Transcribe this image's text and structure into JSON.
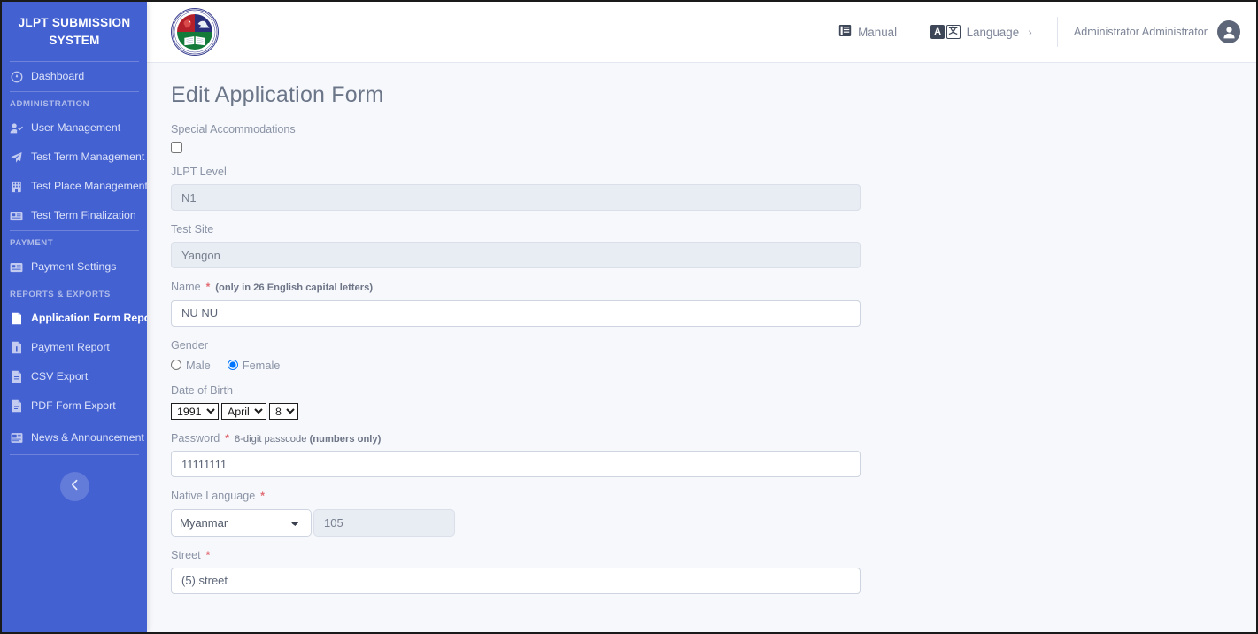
{
  "sidebar": {
    "brand": "JLPT SUBMISSION SYSTEM",
    "items": [
      {
        "label": "Dashboard",
        "icon": "dashboard-icon"
      }
    ],
    "sections": [
      {
        "title": "ADMINISTRATION",
        "items": [
          {
            "label": "User Management",
            "icon": "user-check-icon"
          },
          {
            "label": "Test Term Management",
            "icon": "paper-plane-icon"
          },
          {
            "label": "Test Place Management",
            "icon": "building-icon"
          },
          {
            "label": "Test Term Finalization",
            "icon": "card-icon"
          }
        ]
      },
      {
        "title": "PAYMENT",
        "items": [
          {
            "label": "Payment Settings",
            "icon": "card-icon"
          }
        ]
      },
      {
        "title": "REPORTS & EXPORTS",
        "items": [
          {
            "label": "Application Form Report",
            "icon": "file-icon",
            "active": true
          },
          {
            "label": "Payment Report",
            "icon": "file-icon"
          },
          {
            "label": "CSV Export",
            "icon": "file-icon"
          },
          {
            "label": "PDF Form Export",
            "icon": "file-icon"
          }
        ]
      },
      {
        "title": "",
        "items": [
          {
            "label": "News & Announcement",
            "icon": "news-icon"
          }
        ]
      }
    ],
    "collapse_label": "<",
    "accent_color": "#4461d2"
  },
  "topbar": {
    "logo_alt": "institute-seal-logo",
    "manual_label": "Manual",
    "language_label": "Language",
    "language_chevron": "›",
    "admin_name": "Administrator Administrator"
  },
  "page": {
    "title": "Edit Application Form"
  },
  "form": {
    "special_accommodations": {
      "label": "Special Accommodations",
      "checked": false
    },
    "jlpt_level": {
      "label": "JLPT Level",
      "value": "N1",
      "readonly": true
    },
    "test_site": {
      "label": "Test Site",
      "value": "Yangon",
      "readonly": true
    },
    "name": {
      "label": "Name",
      "required_mark": "*",
      "hint": "(only in 26 English capital letters)",
      "value": "NU NU",
      "placeholder": ""
    },
    "gender": {
      "label": "Gender",
      "options": [
        {
          "label": "Male",
          "selected": false
        },
        {
          "label": "Female",
          "selected": true
        }
      ]
    },
    "date_of_birth": {
      "label": "Date of Birth",
      "year": "1991",
      "month": "April",
      "day": "8"
    },
    "password": {
      "label": "Password",
      "required_mark": "*",
      "hint_normal": "8-digit passcode ",
      "hint_bold": "(numbers only)",
      "value": "11111111"
    },
    "native_language": {
      "label": "Native Language",
      "required_mark": "*",
      "value": "Myanmar",
      "code": "105"
    },
    "street": {
      "label": "Street",
      "required_mark": "*",
      "value": "(5) street"
    }
  }
}
